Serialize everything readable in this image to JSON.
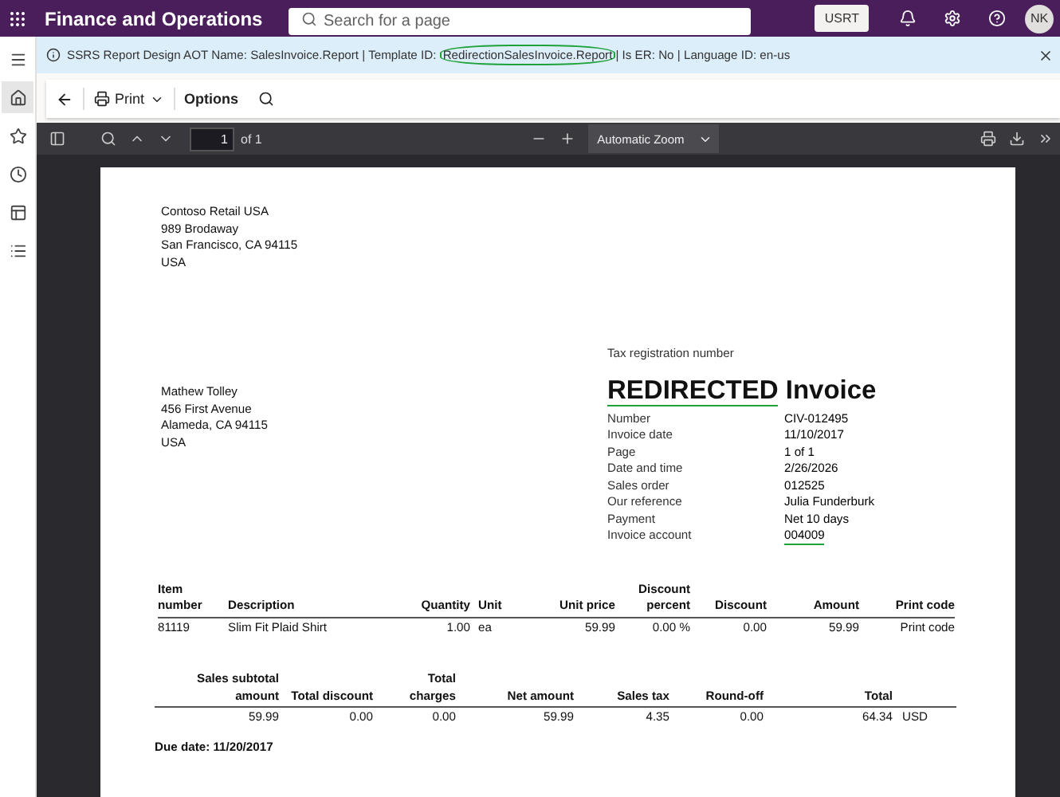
{
  "header": {
    "app_title": "Finance and Operations",
    "search": {
      "placeholder": "Search for a page"
    },
    "company": "USRT",
    "avatar": "NK"
  },
  "nav_rail": {
    "items": [
      {
        "kind": "menu",
        "selected": false
      },
      {
        "kind": "home",
        "selected": true
      },
      {
        "kind": "star",
        "selected": false
      },
      {
        "kind": "clock",
        "selected": false
      },
      {
        "kind": "workspace",
        "selected": false
      },
      {
        "kind": "list",
        "selected": false
      }
    ]
  },
  "info_bar": {
    "parts": [
      {
        "text": "SSRS Report Design AOT Name: SalesInvoice.Report | Template ID: ",
        "circled": false
      },
      {
        "text": "RedirectionSalesInvoice.Report",
        "circled": true
      },
      {
        "text": "| Is ER: No | Language ID: en-us",
        "circled": false
      }
    ]
  },
  "action_pane": {
    "print": "Print",
    "options": "Options"
  },
  "pdf_toolbar": {
    "page": "1",
    "page_count": "of 1",
    "zoom": "Automatic Zoom"
  },
  "invoice": {
    "sender": [
      "Contoso Retail USA",
      "989 Brodaway",
      "San Francisco, CA 94115",
      "USA"
    ],
    "tax_registration_label": "Tax registration number",
    "customer": [
      "Mathew Tolley",
      "456 First Avenue",
      "Alameda, CA 94115",
      "USA"
    ],
    "title": [
      {
        "text": "REDIRECTED",
        "underlined": true
      },
      {
        "text": "Invoice",
        "underlined": false
      }
    ],
    "details": [
      {
        "label": "Number",
        "value": "CIV-012495",
        "underlined": false
      },
      {
        "label": "Invoice date",
        "value": "11/10/2017",
        "underlined": false
      },
      {
        "label": "Page",
        "value": "1 of 1",
        "underlined": false
      },
      {
        "label": "Date and time",
        "value": "2/26/2026",
        "underlined": false
      },
      {
        "label": "Sales order",
        "value": "012525",
        "underlined": false
      },
      {
        "label": "Our reference",
        "value": "Julia Funderburk",
        "underlined": false
      },
      {
        "label": "Payment",
        "value": "Net 10 days",
        "underlined": false
      },
      {
        "label": "Invoice account",
        "value": "004009",
        "underlined": true
      }
    ],
    "lines": {
      "columns": [
        "Item number",
        "Description",
        "Quantity",
        "Unit",
        "Unit price",
        "Discount percent",
        "Discount",
        "Amount",
        "Print code"
      ],
      "rows": [
        [
          "81119",
          "Slim Fit Plaid Shirt",
          "1.00",
          "ea",
          "59.99",
          "0.00 %",
          "0.00",
          "59.99",
          "Print code"
        ]
      ]
    },
    "totals": {
      "columns": [
        "Sales subtotal amount",
        "Total discount",
        "Total charges",
        "Net amount",
        "Sales tax",
        "Round-off",
        "Total"
      ],
      "values": [
        "59.99",
        "0.00",
        "0.00",
        "59.99",
        "4.35",
        "0.00",
        "64.34"
      ],
      "currency": "USD"
    },
    "due_date": "Due date: 11/20/2017"
  }
}
